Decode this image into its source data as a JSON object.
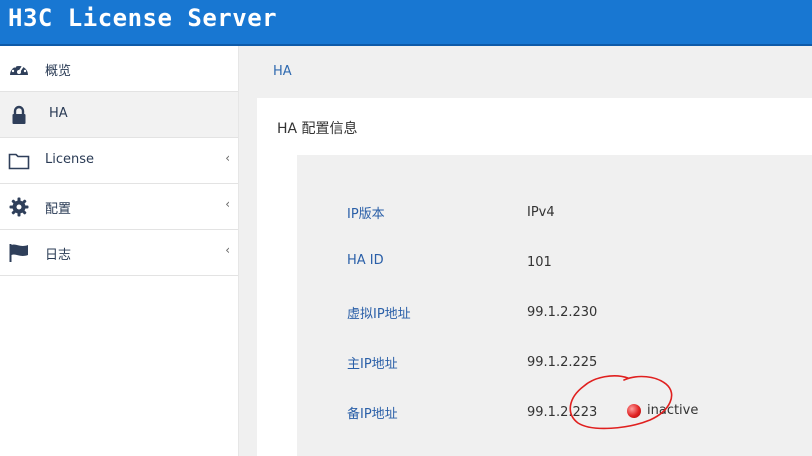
{
  "app": {
    "title": "H3C License Server"
  },
  "sidebar": {
    "items": [
      {
        "label": "概览",
        "icon": "dashboard-icon",
        "active": false,
        "has_submenu": false
      },
      {
        "label": "HA",
        "icon": "lock-icon",
        "active": true,
        "has_submenu": false
      },
      {
        "label": "License",
        "icon": "folder-icon",
        "active": false,
        "has_submenu": true
      },
      {
        "label": "配置",
        "icon": "gear-icon",
        "active": false,
        "has_submenu": true
      },
      {
        "label": "日志",
        "icon": "flag-icon",
        "active": false,
        "has_submenu": true
      }
    ]
  },
  "breadcrumb": {
    "text": "HA"
  },
  "panel": {
    "title": "HA 配置信息"
  },
  "ha_info": {
    "rows": [
      {
        "label": "IP版本",
        "value": "IPv4"
      },
      {
        "label": "HA ID",
        "value": "101"
      },
      {
        "label": "虚拟IP地址",
        "value": "99.1.2.230"
      },
      {
        "label": "主IP地址",
        "value": "99.1.2.225"
      },
      {
        "label": "备IP地址",
        "value": "99.1.2.223"
      }
    ],
    "standby_status": "inactive"
  },
  "colors": {
    "topbar": "#1877d2",
    "link": "#2a5fa8",
    "status_red": "#e02323",
    "annotation": "#e0201f"
  }
}
